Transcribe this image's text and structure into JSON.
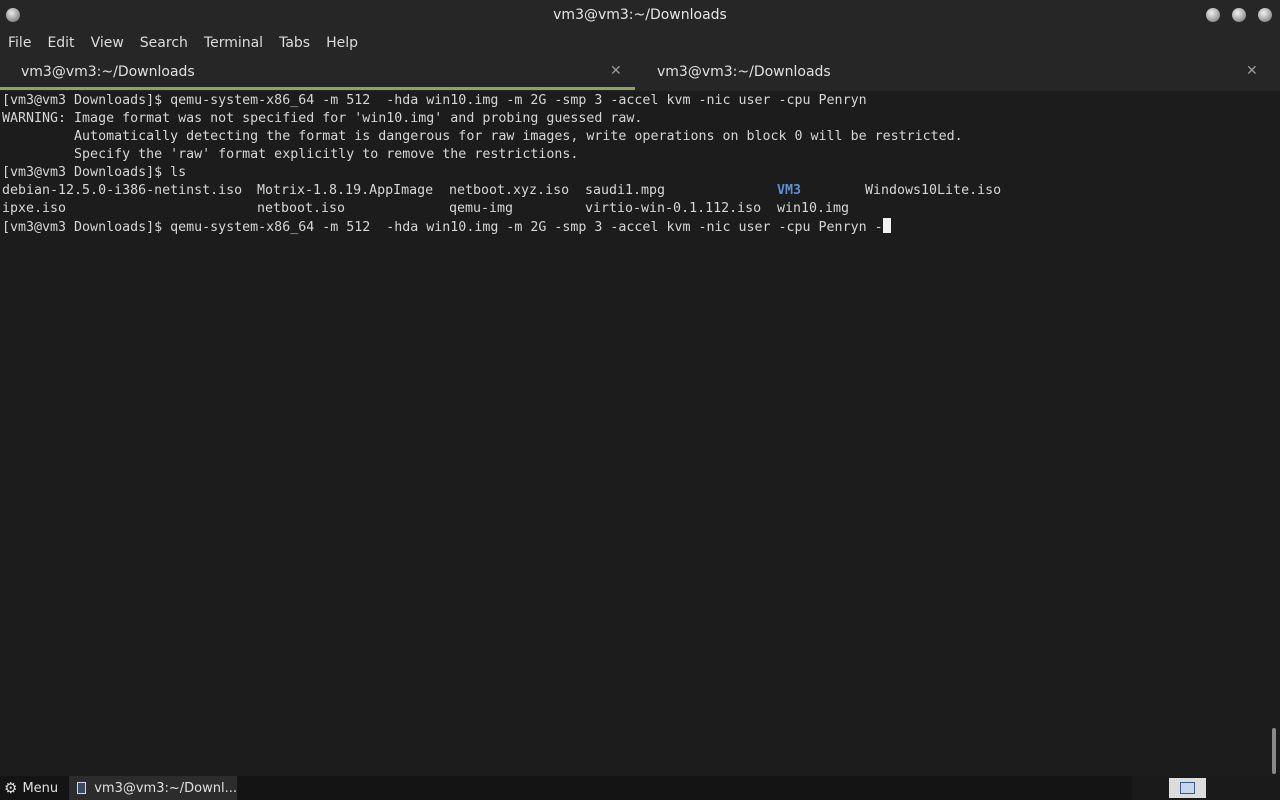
{
  "window": {
    "title": "vm3@vm3:~/Downloads"
  },
  "menu": {
    "items": [
      "File",
      "Edit",
      "View",
      "Search",
      "Terminal",
      "Tabs",
      "Help"
    ]
  },
  "tabs": [
    {
      "label": "vm3@vm3:~/Downloads",
      "close": "✕",
      "active": true
    },
    {
      "label": "vm3@vm3:~/Downloads",
      "close": "✕",
      "active": false
    }
  ],
  "terminal": {
    "lines": [
      "[vm3@vm3 Downloads]$ qemu-system-x86_64 -m 512  -hda win10.img -m 2G -smp 3 -accel kvm -nic user -cpu Penryn",
      "WARNING: Image format was not specified for 'win10.img' and probing guessed raw.",
      "         Automatically detecting the format is dangerous for raw images, write operations on block 0 will be restricted.",
      "         Specify the 'raw' format explicitly to remove the restrictions.",
      "[vm3@vm3 Downloads]$ ls"
    ],
    "ls_row1": [
      "debian-12.5.0-i386-netinst.iso",
      "Motrix-1.8.19.AppImage",
      "netboot.xyz.iso",
      "saudi1.mpg",
      "VM3",
      "Windows10Lite.iso"
    ],
    "ls_row2": [
      "ipxe.iso",
      "netboot.iso",
      "qemu-img",
      "virtio-win-0.1.112.iso",
      "win10.img"
    ],
    "prompt_line": "[vm3@vm3 Downloads]$ qemu-system-x86_64 -m 512  -hda win10.img -m 2G -smp 3 -accel kvm -nic user -cpu Penryn -"
  },
  "taskbar": {
    "menu_label": "Menu",
    "task_label": "vm3@vm3:~/Downl..."
  },
  "colors": {
    "directory": "#5b8fd6",
    "tab_accent": "#8fa35e"
  },
  "icons": {
    "window_menu": "circle-icon",
    "start": "gear-icon",
    "task": "window-icon"
  }
}
